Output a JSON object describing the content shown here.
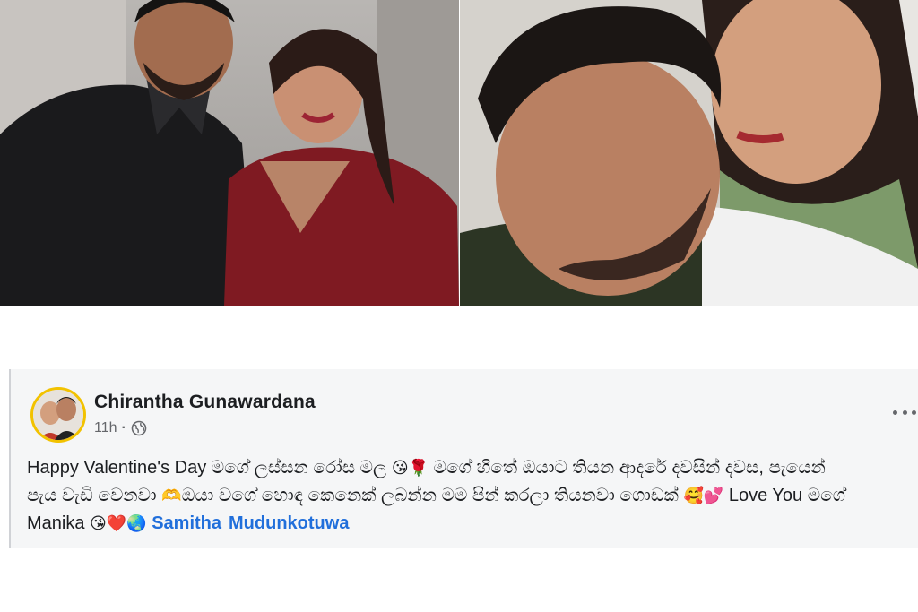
{
  "post": {
    "author_name": "Chirantha Gunawardana",
    "timestamp": "11h",
    "privacy_icon": "globe-icon",
    "more_options_icon": "more-dots-icon",
    "line1": "Happy Valentine's Day මගේ ලස්සන රෝස මල",
    "emoji_kiss": "😘",
    "emoji_rose": "🌹",
    "line1_cont": "මගේ හිතේ ඔයාට තියන ආදරේ දවසින් දවස, පැයෙන්",
    "line2": "පැය වැඩි වෙනවා",
    "emoji_hands": "🫶",
    "line2_cont": "ඔයා වගේ හොඳ කෙනෙක් ලබන්න මම පින් කරලා තියනවා ගොඩක්",
    "emoji_love": "🥰💕",
    "line2_end": "Love You මගේ",
    "line3": "Manika",
    "emoji_end": "😘❤️🌏",
    "mention_1": "Samitha",
    "mention_2": "Mudunkotuwa"
  },
  "colors": {
    "card_background": "#f5f6f7",
    "mention_blue": "#216fdb",
    "avatar_ring": "#f2c200"
  }
}
